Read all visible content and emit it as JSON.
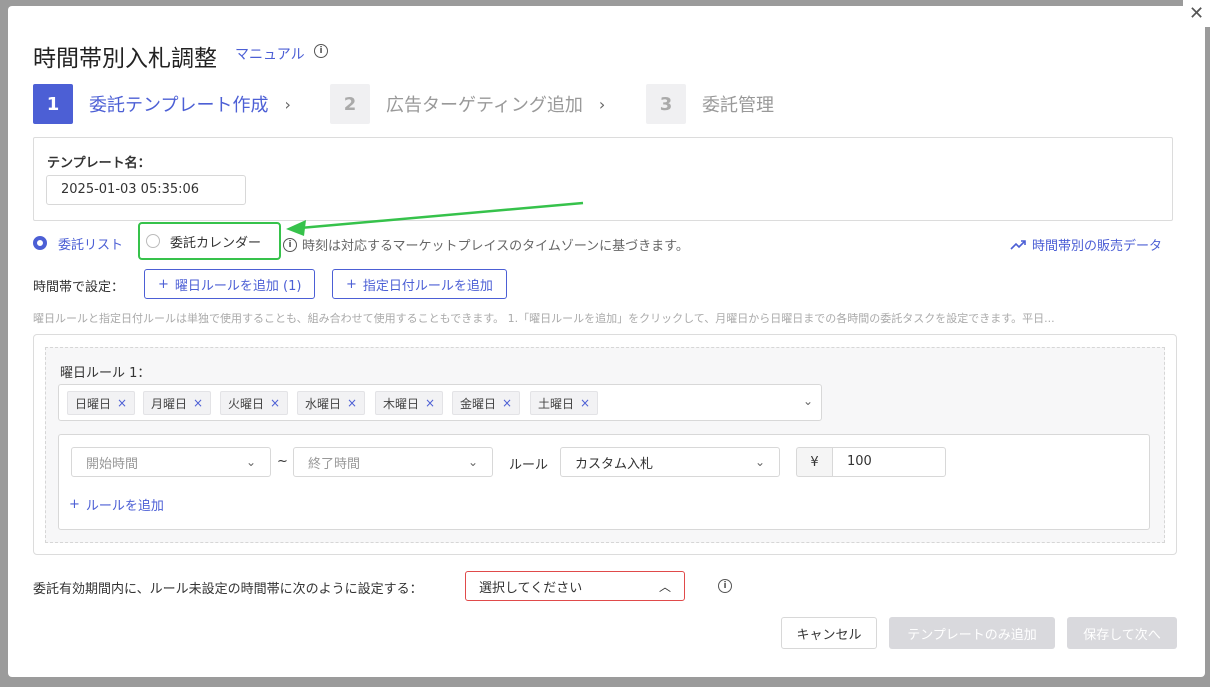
{
  "modal": {
    "title": "時間帯別入札調整",
    "manual_link": "マニュアル",
    "close_glyph": "✕"
  },
  "steps": [
    {
      "num": "1",
      "label": "委託テンプレート作成",
      "active": true
    },
    {
      "num": "2",
      "label": "広告ターゲティング追加",
      "active": false
    },
    {
      "num": "3",
      "label": "委託管理",
      "active": false
    }
  ],
  "template": {
    "label": "テンプレート名：",
    "value": "2025-01-03 05:35:06"
  },
  "mode": {
    "list_label": "委託リスト",
    "calendar_label": "委託カレンダー",
    "selected": "list",
    "timezone_note": "時刻は対応するマーケットプレイスのタイムゾーンに基づきます。",
    "sales_link": "時間帯別の販売データ"
  },
  "timeslot": {
    "label": "時間帯で設定：",
    "add_weekday_rule": "曜日ルールを追加 (1)",
    "add_date_rule": "指定日付ルールを追加",
    "hint": "曜日ルールと指定日付ルールは単独で使用することも、組み合わせて使用することもできます。 1.「曜日ルールを追加」をクリックして、月曜日から日曜日までの各時間の委託タスクを設定できます。平日..."
  },
  "weekday_rule": {
    "title": "曜日ルール 1：",
    "days": [
      "日曜日",
      "月曜日",
      "火曜日",
      "水曜日",
      "木曜日",
      "金曜日",
      "土曜日"
    ],
    "start_placeholder": "開始時間",
    "end_placeholder": "終了時間",
    "tilde": "~",
    "rule_label": "ルール",
    "rule_value": "カスタム入札",
    "currency": "¥",
    "amount": "100",
    "add_rule": "ルールを追加"
  },
  "unset": {
    "label": "委託有効期間内に、ルール未設定の時間帯に次のように設定する：",
    "placeholder": "選択してください"
  },
  "footer": {
    "cancel": "キャンセル",
    "template_only": "テンプレートのみ追加",
    "save_next": "保存して次へ"
  },
  "colors": {
    "accent": "#4c5fd5",
    "highlight": "#36c24b",
    "error": "#e04a4a"
  }
}
